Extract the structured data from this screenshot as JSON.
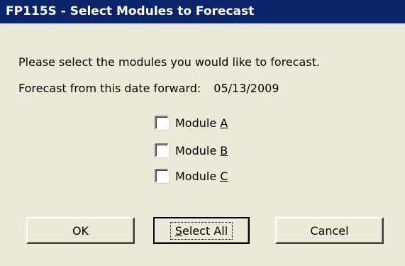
{
  "window": {
    "title": "FP115S - Select Modules to Forecast"
  },
  "body": {
    "instruction": "Please select the modules you would like to forecast.",
    "forecast_label": "Forecast from this date forward:",
    "forecast_date": "05/13/2009"
  },
  "modules": [
    {
      "label_prefix": "Module ",
      "accel": "A",
      "checked": false
    },
    {
      "label_prefix": "Module ",
      "accel": "B",
      "checked": false
    },
    {
      "label_prefix": "Module ",
      "accel": "C",
      "checked": false
    }
  ],
  "buttons": {
    "ok": "OK",
    "select_all_accel": "S",
    "select_all_rest": "elect All",
    "cancel": "Cancel"
  },
  "colors": {
    "titlebar": "#0a246a",
    "dialog_bg": "#ece9d8"
  }
}
